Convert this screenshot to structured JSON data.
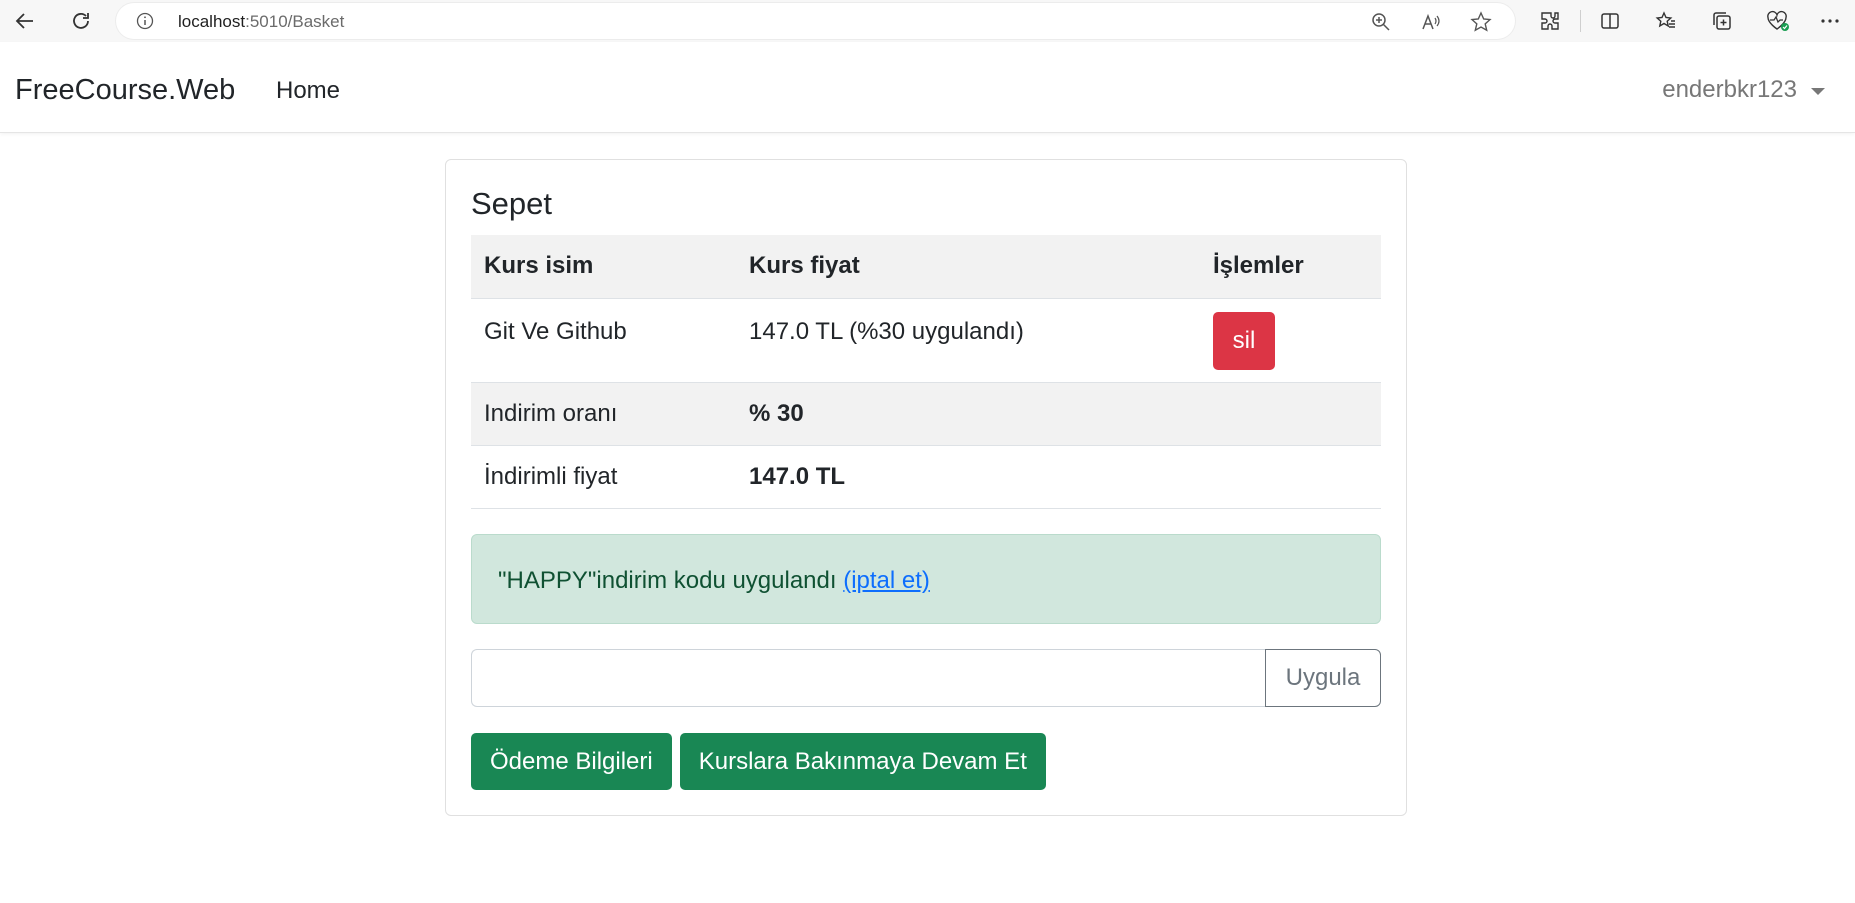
{
  "browser": {
    "url_host": "localhost",
    "url_path": ":5010/Basket"
  },
  "navbar": {
    "brand": "FreeCourse.Web",
    "home": "Home",
    "user": "enderbkr123"
  },
  "basket": {
    "title": "Sepet",
    "columns": [
      "Kurs isim",
      "Kurs fiyat",
      "İşlemler"
    ],
    "item": {
      "name": "Git Ve Github",
      "price": "147.0 TL (%30 uygulandı)",
      "delete_label": "sil"
    },
    "discount_rate_label": "Indirim oranı",
    "discount_rate_value": "% 30",
    "discounted_price_label": "İndirimli fiyat",
    "discounted_price_value": "147.0 TL"
  },
  "alert": {
    "text": "\"HAPPY\"indirim kodu uygulandı",
    "cancel_link": "(iptal et)"
  },
  "coupon": {
    "input_value": "",
    "apply_label": "Uygula"
  },
  "actions": {
    "payment_label": "Ödeme Bilgileri",
    "continue_label": "Kurslara Bakınmaya Devam Et"
  }
}
